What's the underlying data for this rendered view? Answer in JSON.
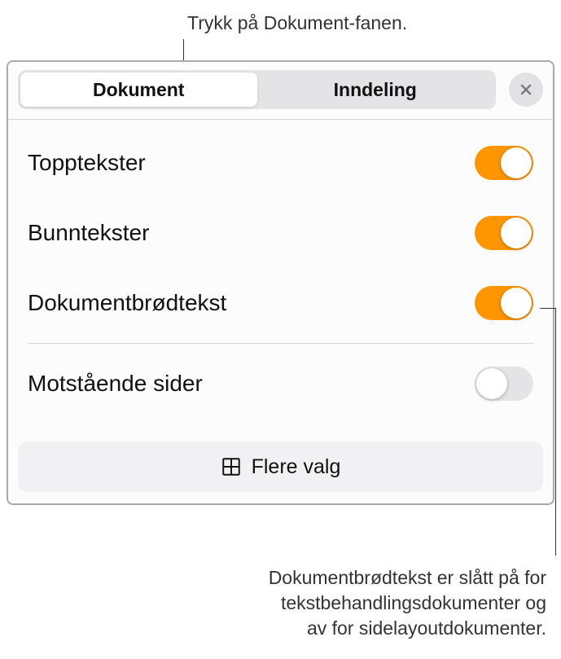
{
  "callouts": {
    "top": "Trykk på Dokument-fanen.",
    "bottom_line1": "Dokumentbrødtekst er slått på for",
    "bottom_line2": "tekstbehandlingsdokumenter og",
    "bottom_line3": "av for sidelayoutdokumenter."
  },
  "tabs": {
    "document": "Dokument",
    "section": "Inndeling"
  },
  "settings": {
    "headers": {
      "label": "Topptekster",
      "on": true
    },
    "footers": {
      "label": "Bunntekster",
      "on": true
    },
    "body": {
      "label": "Dokumentbrødtekst",
      "on": true
    },
    "facing": {
      "label": "Motstående sider",
      "on": false
    }
  },
  "more_options": "Flere valg"
}
